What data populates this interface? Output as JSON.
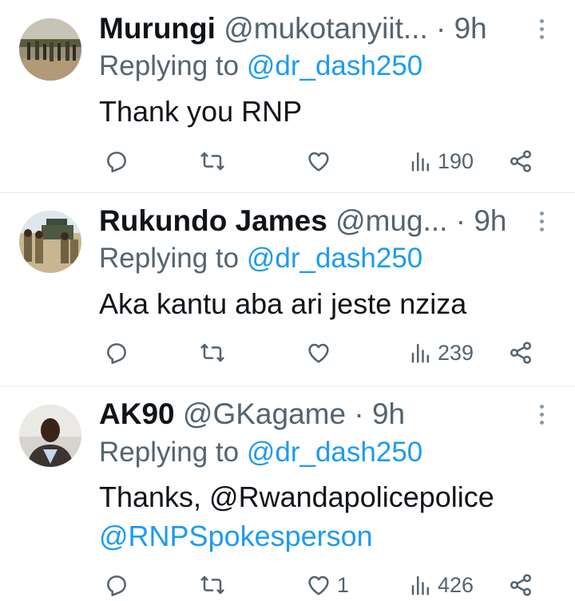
{
  "tweets": [
    {
      "name": "Murungi",
      "handle": "@mukotanyiit...",
      "dot": "·",
      "time": "9h",
      "replying_prefix": "Replying to",
      "replying_to": "@dr_dash250",
      "text_line1": "Thank you RNP",
      "text_line2_mention": "",
      "likes": "",
      "views": "190"
    },
    {
      "name": "Rukundo James",
      "handle": "@mug...",
      "dot": "·",
      "time": "9h",
      "replying_prefix": "Replying to",
      "replying_to": "@dr_dash250",
      "text_line1": "Aka kantu aba ari jeste nziza",
      "text_line2_mention": "",
      "likes": "",
      "views": "239"
    },
    {
      "name": "AK90",
      "handle": "@GKagame",
      "dot": "·",
      "time": "9h",
      "replying_prefix": "Replying to",
      "replying_to": "@dr_dash250",
      "text_line1": "Thanks, @Rwandapolicepolice",
      "text_line2_mention": "@RNPSpokesperson",
      "likes": "1",
      "views": "426"
    }
  ],
  "icons": {
    "reply": "reply-icon",
    "retweet": "retweet-icon",
    "like": "heart-icon",
    "views": "views-icon",
    "share": "share-icon",
    "more": "more-options-icon"
  },
  "colors": {
    "link": "#1d9bf0",
    "secondary_text": "#536471",
    "primary_text": "#0f1419",
    "separator": "#e6e9ec"
  }
}
